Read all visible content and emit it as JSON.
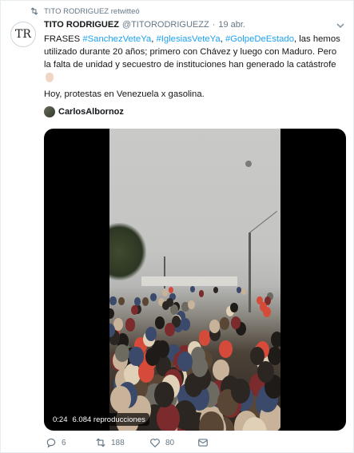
{
  "retweet": {
    "label": "TITO RODRIGUEZ retwitteó"
  },
  "tweet": {
    "avatar_initials": "TR",
    "name": "TITO RODRIGUEZ",
    "handle": "@TITORODRIGUEZZ",
    "separator": "·",
    "date": "19 abr.",
    "text_line1_pre": "FRASES ",
    "hashtag1": "#SanchezVeteYa",
    "comma1": ", ",
    "hashtag2": "#IglesiasVeteYa",
    "comma2": ", ",
    "hashtag3": "#GolpeDeEstado",
    "text_line1_post": ", las hemos",
    "text_line2": "utilizado durante 20 años; primero con Chávez y luego con Maduro. Pero",
    "text_line3": "la falta de unidad y secuestro de instituciones han generado la catástrofe",
    "body2": "Hoy, protestas en Venezuela x gasolina.",
    "author": "CarlosAlbornoz"
  },
  "video": {
    "duration": "0:24",
    "views": "6.084 reproducciones"
  },
  "actions": {
    "reply_count": "6",
    "retweet_count": "188",
    "like_count": "80"
  },
  "colors": {
    "link": "#1da1f2",
    "muted": "#657786"
  }
}
